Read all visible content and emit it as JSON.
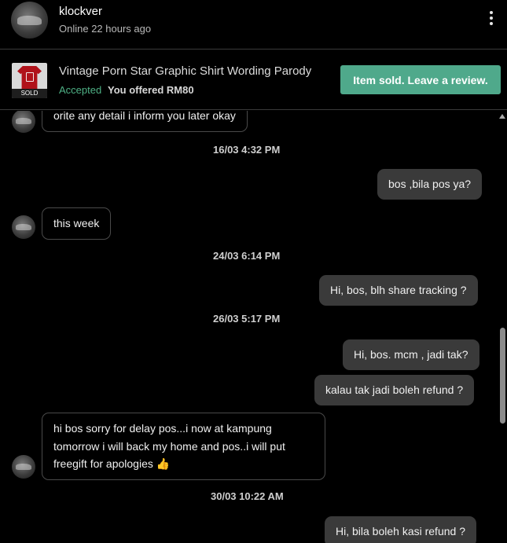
{
  "header": {
    "username": "klockver",
    "status": "Online 22 hours ago",
    "more_icon": "vertical-dots-icon"
  },
  "item": {
    "title": "Vintage Porn Star Graphic Shirt Wording Parody",
    "sold_label": "SOLD",
    "accepted_label": "Accepted",
    "offer_text": "You offered RM80",
    "review_button": "Item sold. Leave a review.",
    "accent_color": "#4fa98b"
  },
  "messages": [
    {
      "type": "in",
      "text": "orite any detail i inform you later okay"
    },
    {
      "type": "timestamp",
      "text": "16/03  4:32 PM"
    },
    {
      "type": "out",
      "text": "bos ,bila pos ya?"
    },
    {
      "type": "in",
      "text": "this week"
    },
    {
      "type": "timestamp",
      "text": "24/03  6:14 PM"
    },
    {
      "type": "out",
      "text": "Hi, bos, blh share tracking ?"
    },
    {
      "type": "timestamp",
      "text": "26/03  5:17 PM"
    },
    {
      "type": "out",
      "text": "Hi, bos. mcm , jadi tak?"
    },
    {
      "type": "out",
      "text": "kalau tak jadi boleh refund ?"
    },
    {
      "type": "in",
      "lines": [
        "hi bos sorry for delay pos...i now at kampung",
        "tomorrow i will back my home and pos..i will put",
        "freegift for apologies 👍"
      ]
    },
    {
      "type": "timestamp",
      "text": "30/03  10:22 AM"
    },
    {
      "type": "out",
      "text": "Hi, bila boleh kasi refund ?"
    }
  ]
}
